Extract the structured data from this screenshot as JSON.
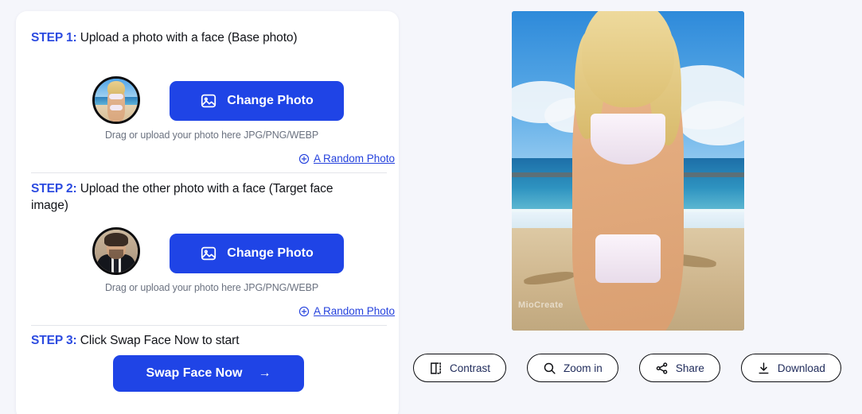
{
  "theme": {
    "page_background": "#f5f6fb",
    "card_background": "#ffffff",
    "accent_blue": "#1f44e6",
    "step_label_blue": "#2c4be0",
    "link_blue": "#2542dd",
    "hint_gray": "#6b7280",
    "outline_black": "#0b0c10"
  },
  "steps": [
    {
      "label": "STEP 1:",
      "text": " Upload a photo with a face (Base photo)",
      "button": "Change Photo",
      "hint": "Drag or upload your photo here JPG/PNG/WEBP",
      "random_link": "A Random Photo",
      "avatar_alt": "base-photo-thumbnail"
    },
    {
      "label": "STEP 2:",
      "text": " Upload the other photo with a face (Target face image)",
      "button": "Change Photo",
      "hint": "Drag or upload your photo here JPG/PNG/WEBP",
      "random_link": "A Random Photo",
      "avatar_alt": "target-face-thumbnail"
    },
    {
      "label": "STEP 3:",
      "text": " Click Swap Face Now to start",
      "button": "Swap Face Now",
      "button_arrow": "→"
    }
  ],
  "preview": {
    "watermark": "MioCreate",
    "alt": "beach-portrait-result"
  },
  "toolbar": [
    {
      "label": "Contrast",
      "icon": "contrast-icon"
    },
    {
      "label": "Zoom in",
      "icon": "zoom-in-icon"
    },
    {
      "label": "Share",
      "icon": "share-icon"
    },
    {
      "label": "Download",
      "icon": "download-icon"
    }
  ],
  "icons": {
    "photo": "image-icon",
    "plus_circle": "plus-circle-icon"
  }
}
